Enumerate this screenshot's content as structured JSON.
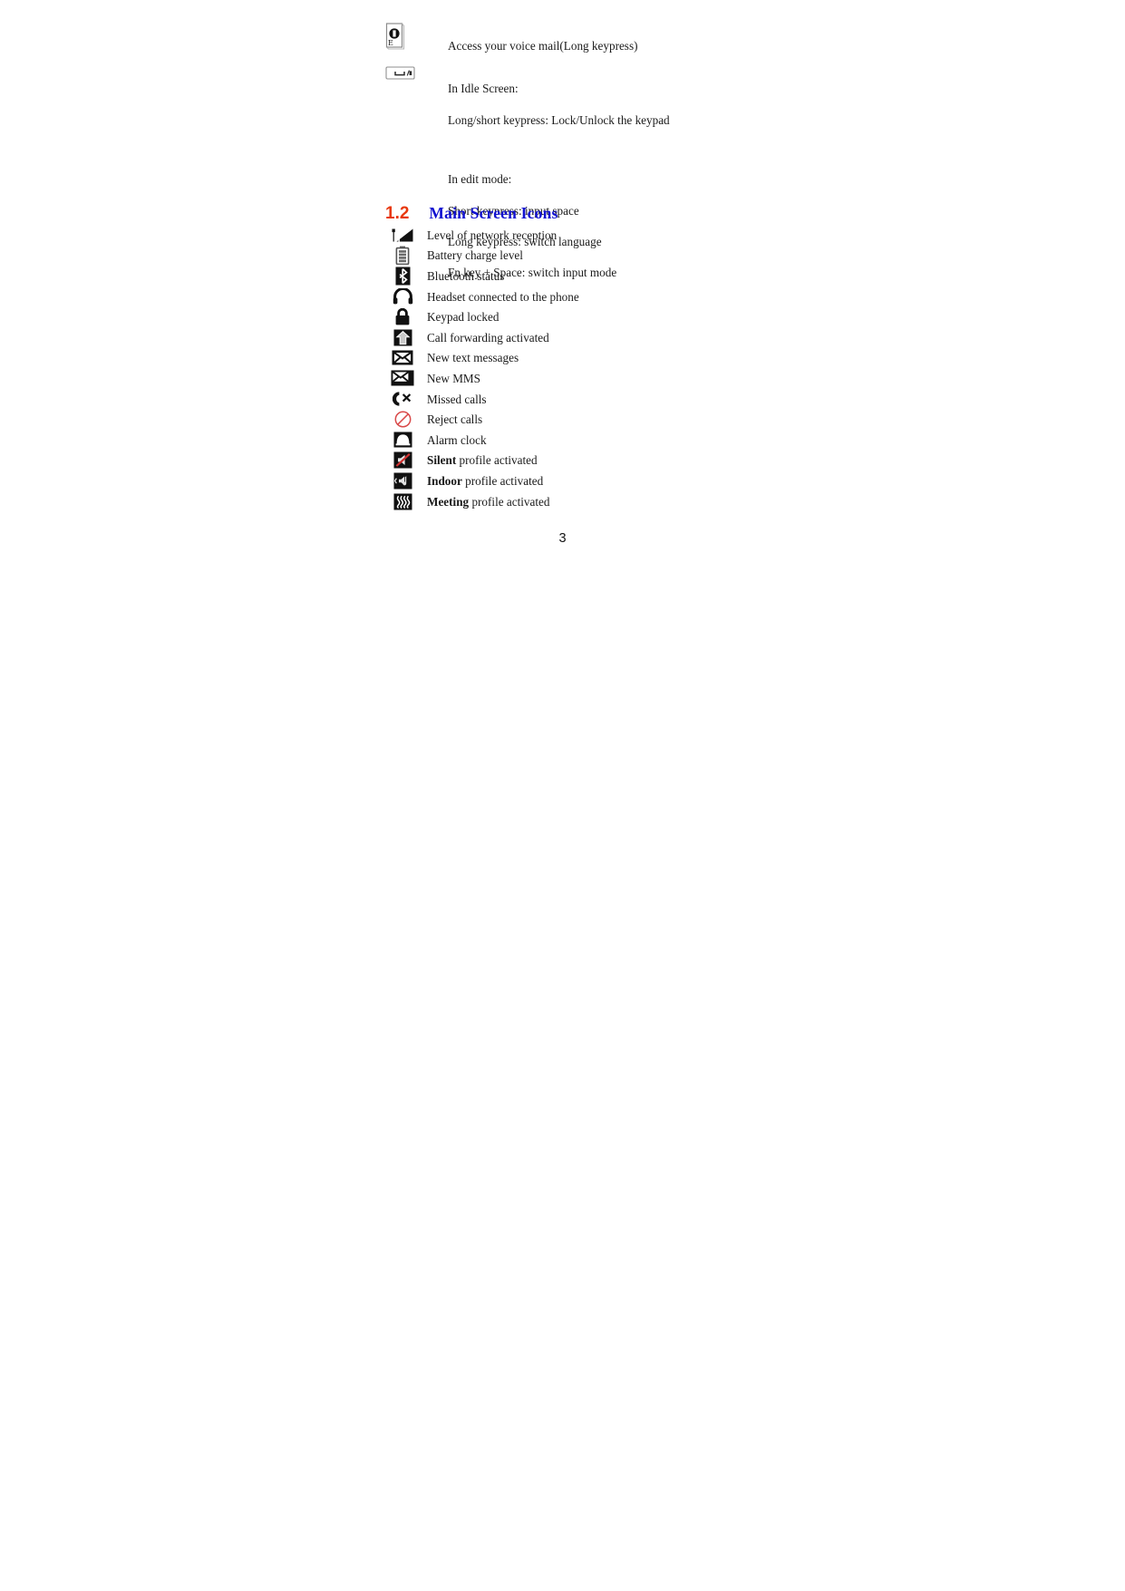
{
  "document": {
    "page_number": "3",
    "colors": {
      "heading_number": "#e8380d",
      "heading_title": "#1010d0",
      "body_text": "#1a1a1a",
      "reject_icon": "#d94a4a"
    }
  },
  "key_descriptions": [
    {
      "icon": "voicemail-key-icon",
      "lines": [
        "Access your voice mail(Long keypress)"
      ]
    },
    {
      "icon": "space-key-icon",
      "lines": [
        "In Idle Screen:",
        "Long/short keypress: Lock/Unlock the keypad",
        "",
        "In edit mode:",
        "Short keypress: input space",
        "Long keypress: switch language",
        "Fn key + Space: switch input mode"
      ]
    }
  ],
  "section": {
    "number": "1.2",
    "title": "Main Screen Icons"
  },
  "screen_icons": [
    {
      "icon": "signal-strength-icon",
      "label": "Level of network reception",
      "bold_prefix": ""
    },
    {
      "icon": "battery-icon",
      "label": "Battery charge level",
      "bold_prefix": ""
    },
    {
      "icon": "bluetooth-icon",
      "label": "Bluetooth status",
      "bold_prefix": ""
    },
    {
      "icon": "headset-icon",
      "label": "Headset connected to the phone",
      "bold_prefix": ""
    },
    {
      "icon": "padlock-icon",
      "label": "Keypad locked",
      "bold_prefix": ""
    },
    {
      "icon": "call-forward-icon",
      "label": "Call forwarding activated",
      "bold_prefix": ""
    },
    {
      "icon": "new-sms-icon",
      "label": "New text messages",
      "bold_prefix": ""
    },
    {
      "icon": "new-mms-icon",
      "label": "New MMS",
      "bold_prefix": ""
    },
    {
      "icon": "missed-call-icon",
      "label": "Missed calls",
      "bold_prefix": ""
    },
    {
      "icon": "reject-call-icon",
      "label": "Reject calls",
      "bold_prefix": ""
    },
    {
      "icon": "alarm-clock-icon",
      "label": "Alarm clock",
      "bold_prefix": ""
    },
    {
      "icon": "silent-profile-icon",
      "label": " profile activated",
      "bold_prefix": "Silent"
    },
    {
      "icon": "indoor-profile-icon",
      "label": " profile activated",
      "bold_prefix": "Indoor"
    },
    {
      "icon": "meeting-profile-icon",
      "label": " profile activated",
      "bold_prefix": "Meeting"
    }
  ]
}
